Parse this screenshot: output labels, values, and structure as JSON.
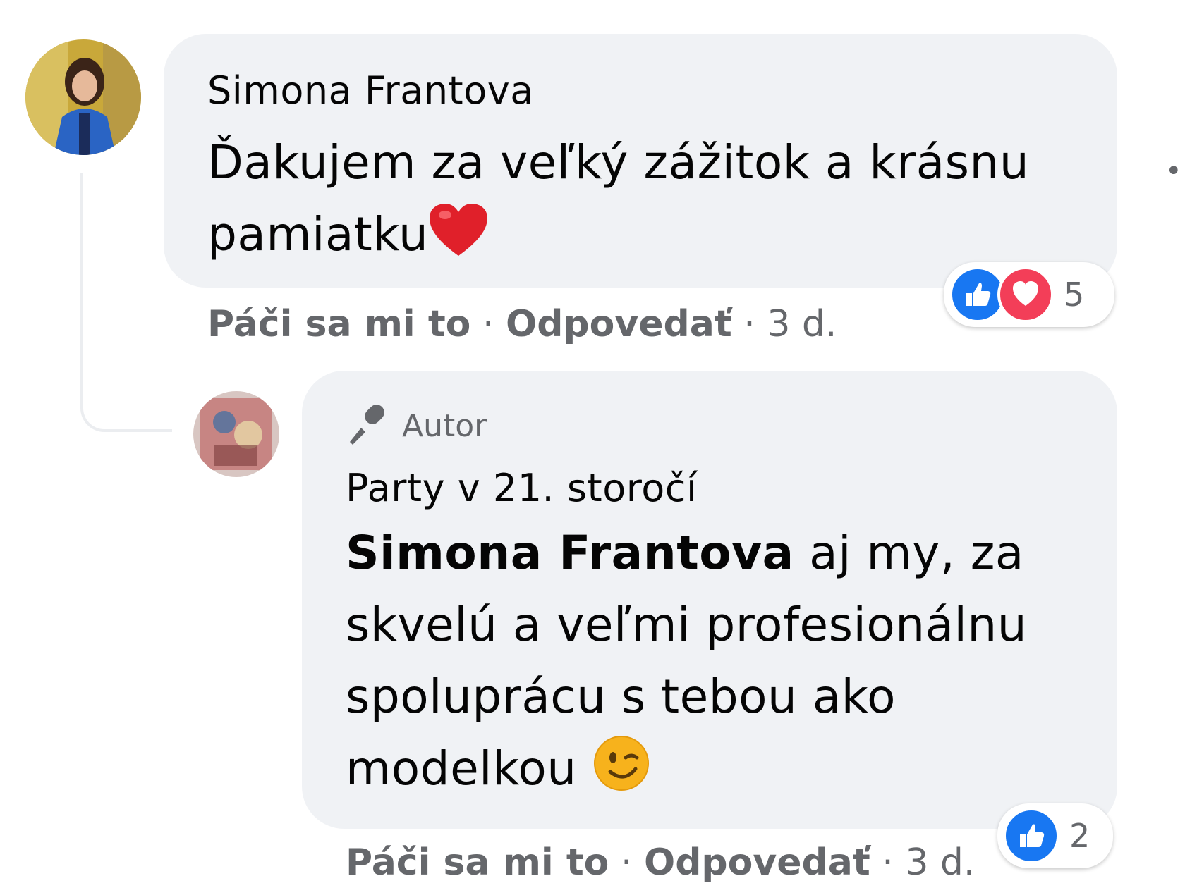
{
  "comment": {
    "author": "Simona Frantova",
    "text": "Ďakujem za veľký zážitok a krásnu pamiatku",
    "emoji": "heart-emoji",
    "reactions": {
      "types": [
        "like",
        "love"
      ],
      "count": "5"
    },
    "actions": {
      "like": "Páči sa mi to",
      "reply": "Odpovedať",
      "separator": "·",
      "time": "3 d."
    },
    "more_icon": "more-dots-icon"
  },
  "reply": {
    "badge": "Autor",
    "badge_icon": "microphone-icon",
    "author": "Party v 21. storočí",
    "mention": "Simona Frantova",
    "text": " aj my, za skvelú a veľmi profesionálnu spoluprácu s tebou ako modelkou ",
    "emoji": "wink-emoji",
    "reactions": {
      "types": [
        "like"
      ],
      "count": "2"
    },
    "actions": {
      "like": "Páči sa mi to",
      "reply": "Odpovedať",
      "separator": "·",
      "time": "3 d."
    }
  },
  "colors": {
    "bubble": "#f0f2f5",
    "secondary_text": "#65676b",
    "like_blue": "#1877f2",
    "love_red": "#f33e58"
  }
}
